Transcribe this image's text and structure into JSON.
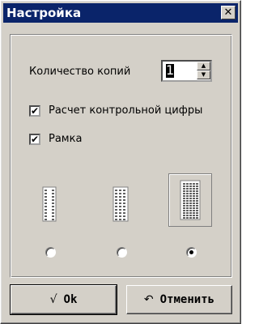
{
  "window": {
    "title": "Настройка",
    "close_glyph": "✕"
  },
  "copies": {
    "label": "Количество копий",
    "value": "1",
    "up_glyph": "▲",
    "down_glyph": "▼"
  },
  "options": [
    {
      "label": "Расчет контрольной цифры",
      "checked": true,
      "check_glyph": "✔"
    },
    {
      "label": "Рамка",
      "checked": true,
      "check_glyph": "✔"
    }
  ],
  "layouts": [
    {
      "name": "single-column",
      "selected": false
    },
    {
      "name": "double-column",
      "selected": false
    },
    {
      "name": "grid",
      "selected": true
    }
  ],
  "buttons": {
    "ok_label": "Ok",
    "ok_icon": "√",
    "cancel_label": "Отменить",
    "cancel_icon": "↶"
  }
}
